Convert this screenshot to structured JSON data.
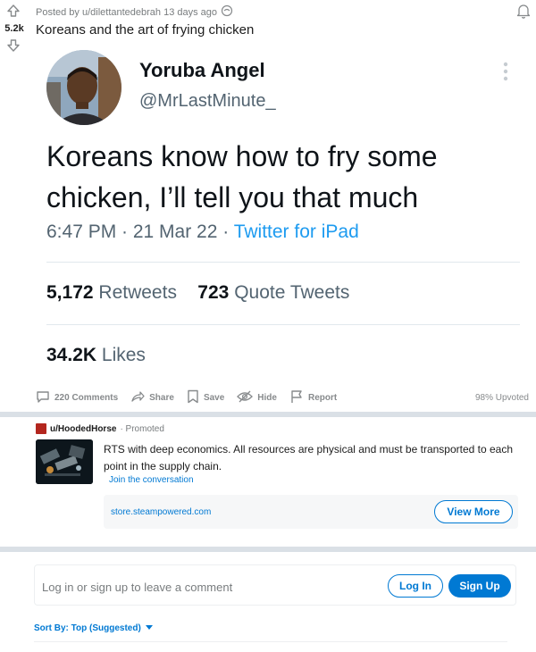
{
  "post": {
    "score": "5.2k",
    "posted_by": "Posted by u/dilettantedebrah 13 days ago",
    "title": "Koreans and the art of frying chicken"
  },
  "tweet": {
    "name": "Yoruba Angel",
    "handle": "@MrLastMinute_",
    "text": "Koreans know how to fry some chicken, I’ll tell you that much",
    "time": "6:47 PM · 21 Mar 22 · ",
    "source": "Twitter for iPad",
    "retweets_count": "5,172",
    "retweets_label": "Retweets",
    "quotes_count": "723",
    "quotes_label": "Quote Tweets",
    "likes_count": "34.2K",
    "likes_label": "Likes"
  },
  "actions": {
    "comments": "220 Comments",
    "share": "Share",
    "save": "Save",
    "hide": "Hide",
    "report": "Report",
    "upvoted": "98% Upvoted"
  },
  "promo": {
    "user": "u/HoodedHorse",
    "tag": "· Promoted",
    "text": "RTS with deep economics. All resources are physical and must be transported to each point in the supply chain.",
    "join": "Join the conversation",
    "url": "store.steampowered.com",
    "view_more": "View More"
  },
  "comment_bar": {
    "prompt": "Log in or sign up to leave a comment",
    "login": "Log In",
    "signup": "Sign Up"
  },
  "sort": {
    "label": "Sort By: Top (Suggested)"
  },
  "colors": {
    "accent": "#0079d3",
    "twitter_blue": "#1d9bf0",
    "band": "#dae0e6"
  }
}
